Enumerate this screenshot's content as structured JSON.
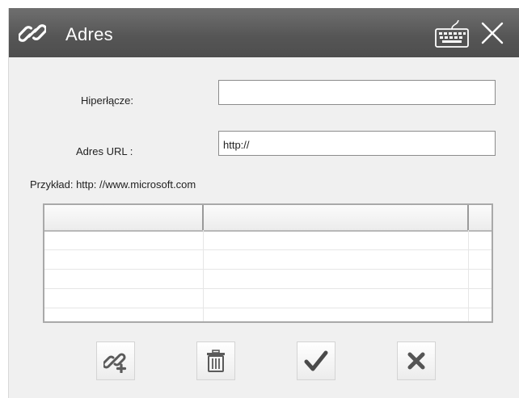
{
  "window": {
    "title": "Adres",
    "icons": {
      "title": "link-icon",
      "keyboard": "keyboard-icon",
      "close": "close-icon"
    }
  },
  "form": {
    "hyperlink_label": "Hiperłącze:",
    "hyperlink_value": "",
    "url_label": "Adres URL :",
    "url_value": "http://",
    "example_text": "Przykład: http: //www.microsoft.com"
  },
  "grid": {
    "columns": [
      "",
      "",
      ""
    ],
    "rows": [
      [
        "",
        "",
        ""
      ],
      [
        "",
        "",
        ""
      ],
      [
        "",
        "",
        ""
      ],
      [
        "",
        "",
        ""
      ]
    ]
  },
  "toolbar": {
    "buttons": [
      {
        "name": "add-link",
        "icon": "add-link-icon"
      },
      {
        "name": "delete",
        "icon": "trash-icon"
      },
      {
        "name": "confirm",
        "icon": "checkmark-icon"
      },
      {
        "name": "cancel",
        "icon": "x-icon"
      }
    ]
  },
  "colors": {
    "titlebar": "#595959",
    "background": "#f0f0f0",
    "field_border": "#8c8c8c",
    "check": "#4a4a4a",
    "x_mark": "#555555"
  }
}
